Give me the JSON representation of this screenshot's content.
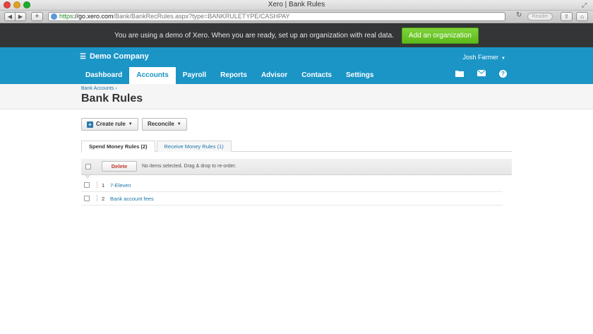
{
  "browser": {
    "window_title": "Xero | Bank Rules",
    "url_https": "https",
    "url_host": "://go.xero.com",
    "url_path": "/Bank/BankRecRules.aspx?type=BANKRULETYPE/CASHPAY",
    "reader_label": "Reader",
    "new_tab_label": "+",
    "back_label": "◀",
    "forward_label": "▶"
  },
  "demo_banner": {
    "text": "You are using a demo of Xero. When you are ready, set up an organization with real data.",
    "button_label": "Add an organization"
  },
  "header": {
    "org_name": "Demo Company",
    "user_name": "Josh Farmer",
    "nav": [
      {
        "label": "Dashboard"
      },
      {
        "label": "Accounts"
      },
      {
        "label": "Payroll"
      },
      {
        "label": "Reports"
      },
      {
        "label": "Advisor"
      },
      {
        "label": "Contacts"
      },
      {
        "label": "Settings"
      }
    ],
    "active_nav": "Accounts",
    "help_label": "?"
  },
  "page": {
    "breadcrumb": "Bank Accounts ›",
    "title": "Bank Rules"
  },
  "actions": {
    "create_rule": "Create rule",
    "reconcile": "Reconcile"
  },
  "tabs": [
    {
      "label": "Spend Money Rules (2)",
      "active": true
    },
    {
      "label": "Receive Money Rules (1)",
      "active": false
    }
  ],
  "list": {
    "delete_label": "Delete",
    "selection_info": "No items selected. Drag & drop to re-order.",
    "rules": [
      {
        "number": "1",
        "name": "7-Eleven"
      },
      {
        "number": "2",
        "name": "Bank account fees"
      }
    ]
  },
  "colors": {
    "brand_blue": "#1b95c6",
    "banner_dark": "#333537",
    "cta_green": "#5cb91b",
    "delete_red": "#c0392b"
  }
}
